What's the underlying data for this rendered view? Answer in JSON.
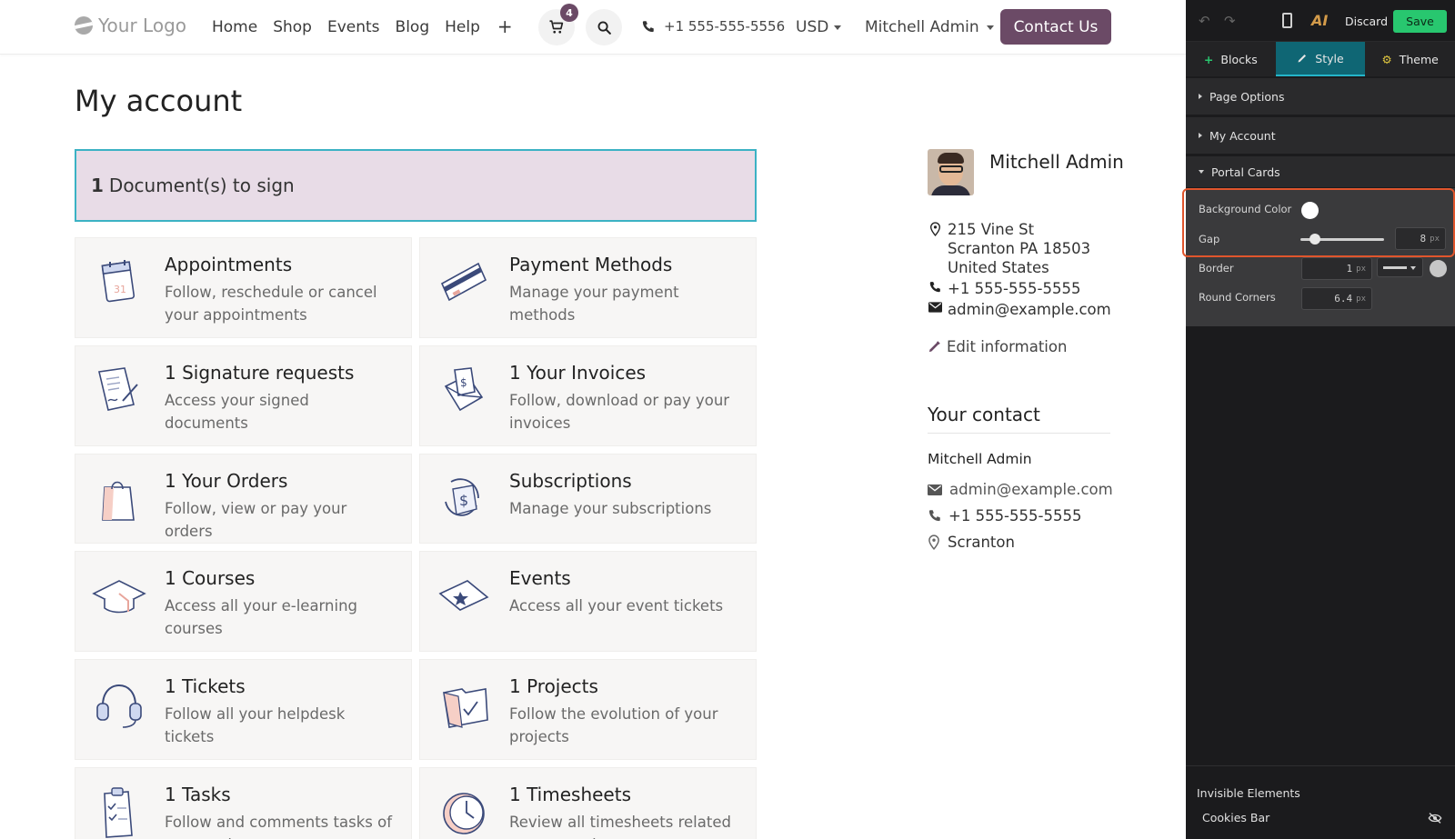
{
  "header": {
    "logo_text": "Your Logo",
    "nav": [
      "Home",
      "Shop",
      "Events",
      "Blog",
      "Help"
    ],
    "add_menu_symbol": "+",
    "cart_count": "4",
    "phone": "+1 555-555-5556",
    "currency": "USD",
    "user": "Mitchell Admin",
    "contact_button": "Contact Us"
  },
  "page": {
    "title": "My account",
    "alert_count": "1",
    "alert_text": "Document(s) to sign"
  },
  "cards": [
    {
      "icon": "calendar-icon",
      "title": "Appointments",
      "desc": "Follow, reschedule or cancel your appointments"
    },
    {
      "icon": "credit-card-icon",
      "title": "Payment Methods",
      "desc": "Manage your payment methods"
    },
    {
      "icon": "signature-icon",
      "title": "1  Signature requests",
      "desc": "Access your signed documents"
    },
    {
      "icon": "invoice-envelope-icon",
      "title": "1  Your Invoices",
      "desc": "Follow, download or pay your invoices"
    },
    {
      "icon": "shopping-bag-icon",
      "title": "1  Your Orders",
      "desc": "Follow, view or pay your orders"
    },
    {
      "icon": "subscription-icon",
      "title": "Subscriptions",
      "desc": "Manage your subscriptions"
    },
    {
      "icon": "graduation-cap-icon",
      "title": "1  Courses",
      "desc": "Access all your e-learning courses"
    },
    {
      "icon": "ticket-icon",
      "title": "Events",
      "desc": "Access all your event tickets"
    },
    {
      "icon": "headset-icon",
      "title": "1  Tickets",
      "desc": "Follow all your helpdesk tickets"
    },
    {
      "icon": "folder-check-icon",
      "title": "1  Projects",
      "desc": "Follow the evolution of your projects"
    },
    {
      "icon": "clipboard-icon",
      "title": "1  Tasks",
      "desc": "Follow and comments tasks of your projects"
    },
    {
      "icon": "clock-icon",
      "title": "1  Timesheets",
      "desc": "Review all timesheets related to your projects"
    }
  ],
  "profile": {
    "name": "Mitchell Admin",
    "address_line1": "215 Vine St",
    "address_line2": "Scranton PA 18503",
    "address_line3": "United States",
    "phone": "+1 555-555-5555",
    "email": "admin@example.com",
    "edit_label": "Edit information"
  },
  "contact": {
    "heading": "Your contact",
    "name": "Mitchell Admin",
    "email": "admin@example.com",
    "phone": "+1 555-555-5555",
    "city": "Scranton"
  },
  "editor": {
    "discard": "Discard",
    "save": "Save",
    "ai_label": "AI",
    "tabs": [
      "Blocks",
      "Style",
      "Theme"
    ],
    "active_tab": "Style",
    "sections": [
      "Page Options",
      "My Account",
      "Portal Cards"
    ],
    "options": {
      "bg_label": "Background Color",
      "gap_label": "Gap",
      "gap_value": "8",
      "border_label": "Border",
      "border_value": "1",
      "corners_label": "Round Corners",
      "corners_value": "6.4",
      "unit": "px"
    },
    "invisible_heading": "Invisible Elements",
    "invisible_item": "Cookies Bar"
  },
  "colors": {
    "brand": "#6b4a66",
    "alert_bg": "#e8dce7",
    "alert_border": "#3bb2c4",
    "save_green": "#28c76f",
    "editor_bg": "#1b1b1d",
    "highlight": "#e0552c"
  }
}
